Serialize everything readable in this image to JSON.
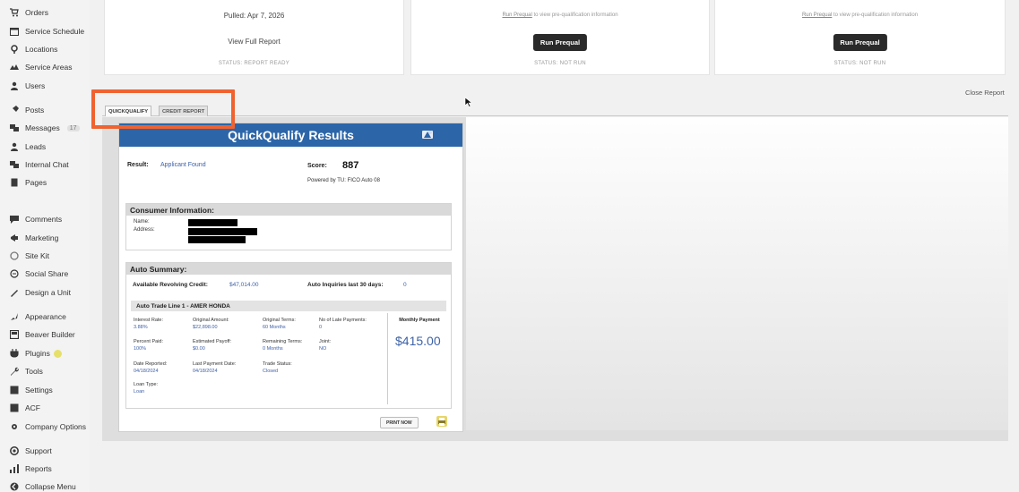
{
  "sidebar": {
    "items": [
      {
        "label": "Orders",
        "icon": "cart-icon"
      },
      {
        "label": "Service Schedule",
        "icon": "calendar-icon"
      },
      {
        "label": "Locations",
        "icon": "pin-icon"
      },
      {
        "label": "Service Areas",
        "icon": "map-icon"
      },
      {
        "label": "Users",
        "icon": "users-icon"
      },
      {
        "label": "Posts",
        "icon": "pin-pushpin-icon"
      },
      {
        "label": "Messages",
        "icon": "message-icon",
        "badge": "17"
      },
      {
        "label": "Leads",
        "icon": "person-icon"
      },
      {
        "label": "Internal Chat",
        "icon": "chat-icon"
      },
      {
        "label": "Pages",
        "icon": "page-icon"
      },
      {
        "label": "Comments",
        "icon": "comment-icon"
      },
      {
        "label": "Marketing",
        "icon": "megaphone-icon"
      },
      {
        "label": "Site Kit",
        "icon": "google-icon"
      },
      {
        "label": "Social Share",
        "icon": "share-icon"
      },
      {
        "label": "Design a Unit",
        "icon": "brush-icon"
      },
      {
        "label": "Appearance",
        "icon": "appearance-icon"
      },
      {
        "label": "Beaver Builder",
        "icon": "builder-icon"
      },
      {
        "label": "Plugins",
        "icon": "plugin-icon",
        "badge": "1"
      },
      {
        "label": "Tools",
        "icon": "wrench-icon"
      },
      {
        "label": "Settings",
        "icon": "settings-icon"
      },
      {
        "label": "ACF",
        "icon": "acf-icon"
      },
      {
        "label": "Company Options",
        "icon": "gear-icon"
      },
      {
        "label": "Support",
        "icon": "support-icon"
      },
      {
        "label": "Reports",
        "icon": "bar-chart-icon"
      },
      {
        "label": "Collapse Menu",
        "icon": "collapse-icon"
      }
    ]
  },
  "cards": {
    "card1": {
      "pulled": "Pulled: Apr 7, 2026",
      "link": "View Full Report",
      "status": "STATUS: REPORT READY"
    },
    "card2": {
      "note_link": "Run Prequal",
      "note_text": " to view pre-qualification information",
      "button": "Run Prequal",
      "status": "STATUS: NOT RUN"
    },
    "card3": {
      "note_link": "Run Prequal",
      "note_text": " to view pre-qualification information",
      "button": "Run Prequal",
      "status": "STATUS: NOT RUN"
    }
  },
  "close_report": "Close Report",
  "tabs": [
    "QUICKQUALIFY",
    "CREDIT REPORT"
  ],
  "report": {
    "title": "QuickQualify Results",
    "result_label": "Result:",
    "result_value": "Applicant Found",
    "score_label": "Score:",
    "score_value": "887",
    "powered_by": "Powered by TU: FICO Auto 08",
    "consumer": {
      "heading": "Consumer Information:",
      "name_label": "Name:",
      "address_label": "Address:"
    },
    "auto": {
      "heading": "Auto Summary:",
      "revolving_label": "Available Revolving Credit:",
      "revolving_value": "$47,014.00",
      "inquiries_label": "Auto Inquiries last 30 days:",
      "inquiries_value": "0",
      "trade_line": "Auto Trade Line 1 - AMER HONDA",
      "fields": {
        "interest_rate_label": "Interest Rate:",
        "interest_rate": "3.88%",
        "original_amount_label": "Original Amount:",
        "original_amount": "$22,898.00",
        "original_terms_label": "Original Terms:",
        "original_terms": "60 Months",
        "late_payments_label": "No of Late Payments:",
        "late_payments": "0",
        "percent_paid_label": "Percent Paid:",
        "percent_paid": "100%",
        "estimated_payoff_label": "Estimated Payoff:",
        "estimated_payoff": "$0.00",
        "remaining_terms_label": "Remaining Terms:",
        "remaining_terms": "0 Months",
        "joint_label": "Joint:",
        "joint": "NO",
        "date_reported_label": "Date Reported:",
        "date_reported": "04/18/2024",
        "last_payment_label": "Last Payment Date:",
        "last_payment": "04/18/2024",
        "trade_status_label": "Trade Status:",
        "trade_status": "Closed",
        "loan_type_label": "Loan Type:",
        "loan_type": "Loan"
      },
      "monthly_label": "Monthly Payment",
      "monthly_value": "$415.00"
    },
    "print_button": "PRINT NOW"
  },
  "colors": {
    "header_blue": "#2c66a8",
    "highlight_orange": "#f0622f",
    "link_blue": "#3d5fa7"
  }
}
